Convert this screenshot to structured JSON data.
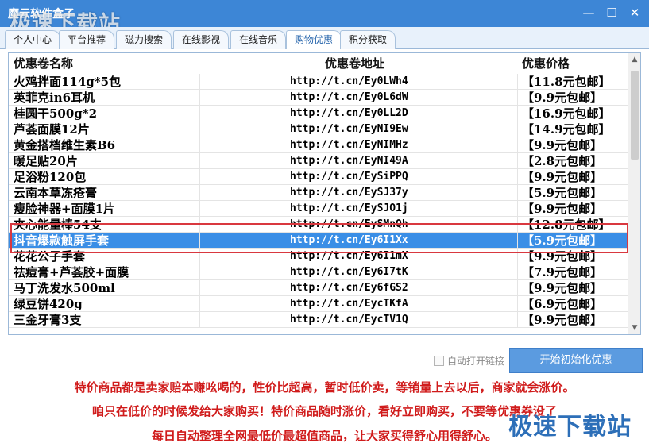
{
  "window": {
    "title": "魔云软件盒子",
    "minimize_glyph": "—",
    "maximize_glyph": "☐",
    "close_glyph": "✕"
  },
  "watermarks": {
    "top": "极速下载站",
    "bottom": "极速下载站"
  },
  "tabs": [
    {
      "label": "个人中心",
      "active": false
    },
    {
      "label": "平台推荐",
      "active": false
    },
    {
      "label": "磁力搜索",
      "active": false
    },
    {
      "label": "在线影视",
      "active": false
    },
    {
      "label": "在线音乐",
      "active": false
    },
    {
      "label": "购物优惠",
      "active": true
    },
    {
      "label": "积分获取",
      "active": false
    }
  ],
  "table": {
    "columns": {
      "name": "优惠卷名称",
      "url": "优惠卷地址",
      "price": "优惠价格"
    },
    "rows": [
      {
        "name": "火鸡拌面114g*5包",
        "url": "http://t.cn/Ey0LWh4",
        "price": "【11.8元包邮】"
      },
      {
        "name": "英菲克in6耳机",
        "url": "http://t.cn/Ey0L6dW",
        "price": "【9.9元包邮】"
      },
      {
        "name": "桂圆干500g*2",
        "url": "http://t.cn/Ey0LL2D",
        "price": "【16.9元包邮】"
      },
      {
        "name": "芦荟面膜12片",
        "url": "http://t.cn/EyNI9Ew",
        "price": "【14.9元包邮】"
      },
      {
        "name": "黄金搭档维生素B6",
        "url": "http://t.cn/EyNIMHz",
        "price": "【9.9元包邮】"
      },
      {
        "name": "暖足贴20片",
        "url": "http://t.cn/EyNI49A",
        "price": "【2.8元包邮】"
      },
      {
        "name": "足浴粉120包",
        "url": "http://t.cn/EySiPPQ",
        "price": "【9.9元包邮】"
      },
      {
        "name": "云南本草冻疮膏",
        "url": "http://t.cn/EySJ37y",
        "price": "【5.9元包邮】"
      },
      {
        "name": "瘦脸神器+面膜1片",
        "url": "http://t.cn/EySJO1j",
        "price": "【9.9元包邮】"
      },
      {
        "name": "夹心能量棒54支",
        "url": "http://t.cn/EySMnQh",
        "price": "【12.8元包邮】"
      },
      {
        "name": "抖音爆款触屏手套",
        "url": "http://t.cn/Ey6I1Xx",
        "price": "【5.9元包邮】",
        "selected": true
      },
      {
        "name": "花花公子手套",
        "url": "http://t.cn/Ey6I1mX",
        "price": "【9.9元包邮】"
      },
      {
        "name": "祛痘膏+芦荟胶+面膜",
        "url": "http://t.cn/Ey6I7tK",
        "price": "【7.9元包邮】"
      },
      {
        "name": "马丁洗发水500ml",
        "url": "http://t.cn/Ey6fGS2",
        "price": "【9.9元包邮】"
      },
      {
        "name": "绿豆饼420g",
        "url": "http://t.cn/EycTKfA",
        "price": "【6.9元包邮】"
      },
      {
        "name": "三金牙膏3支",
        "url": "http://t.cn/EycTV1Q",
        "price": "【9.9元包邮】"
      }
    ],
    "scroll_up_glyph": "▲",
    "scroll_down_glyph": "▼"
  },
  "footer": {
    "auto_open_label": "自动打开链接",
    "auto_open_checked": false,
    "start_button_label": "开始初始化优惠"
  },
  "notices": [
    "特价商品都是卖家赔本赚吆喝的，性价比超高，暂时低价卖，等销量上去以后，商家就会涨价。",
    "咱只在低价的时候发给大家购买！特价商品随时涨价，看好立即购买，不要等优惠券没了",
    "每日自动整理全网最低价最超值商品，让大家买得舒心用得舒心。"
  ],
  "colors": {
    "title_bar": "#3d86d6",
    "selected_row": "#3a8ee6",
    "highlight_border": "#d9383f",
    "notice_text": "#d01b1b",
    "button": "#5b9be0"
  }
}
